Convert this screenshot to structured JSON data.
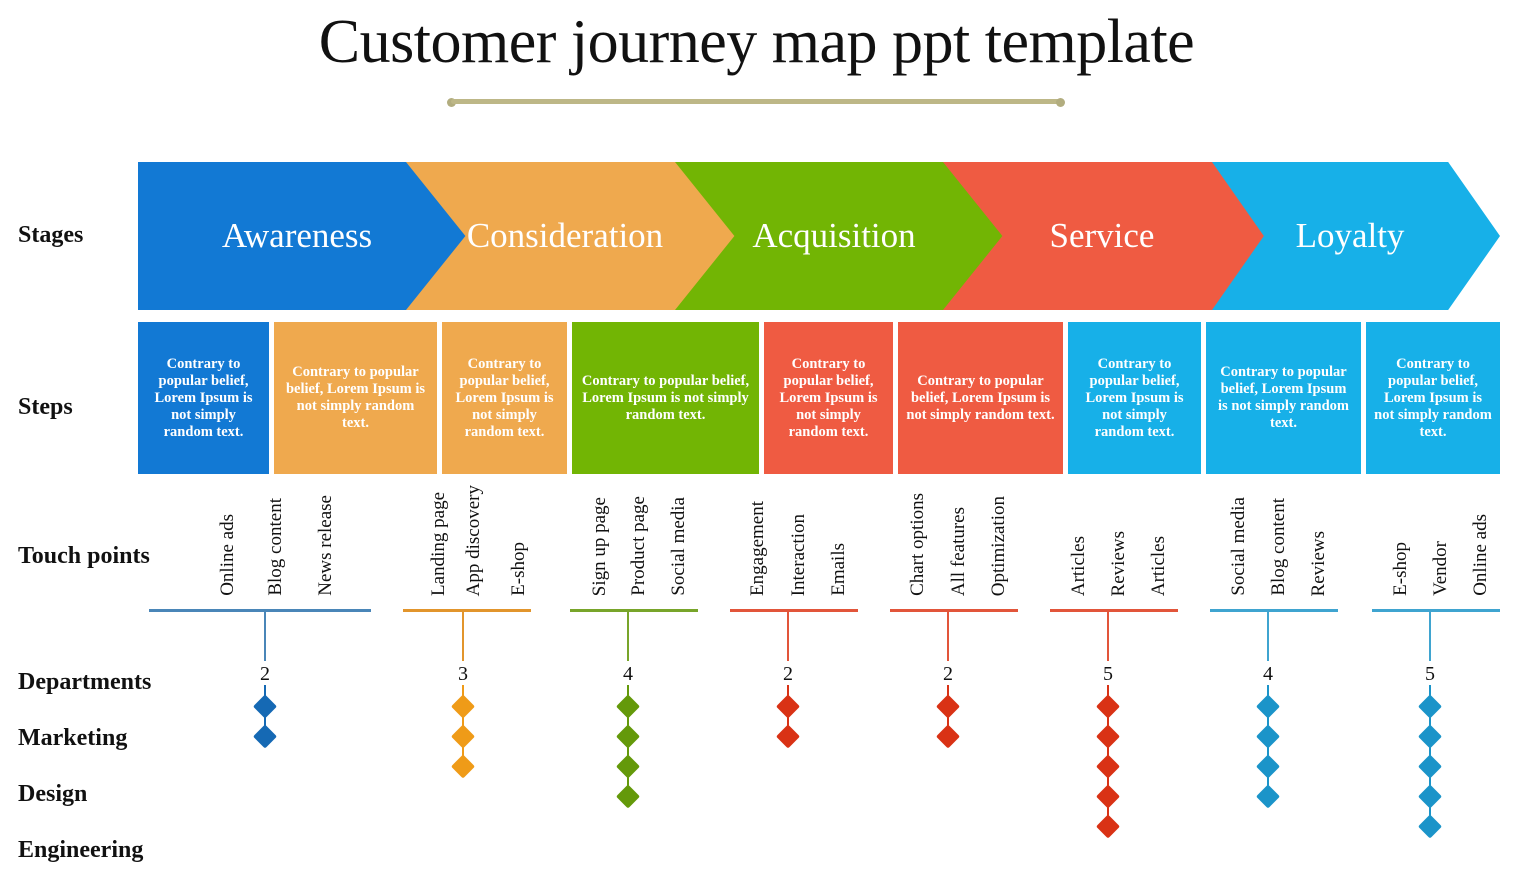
{
  "title": "Customer journey map ppt template",
  "row_labels": {
    "stages": "Stages",
    "steps": "Steps",
    "touch_points": "Touch points",
    "departments": "Departments",
    "marketing": "Marketing",
    "design": "Design",
    "engineering": "Engineering"
  },
  "colors": {
    "blue": "#1279d4",
    "orange": "#efa94e",
    "green": "#72b504",
    "red": "#ef5b42",
    "cyan": "#17b0e8",
    "rule_blue": "#4a86b8",
    "rule_orange": "#e2952c",
    "rule_green": "#78a52a",
    "rule_red": "#e2553a",
    "rule_cyan": "#3fa4d0",
    "title_rule": "#b2ad7f",
    "text_dark": "#111111",
    "text_light": "#ffffff"
  },
  "stages": [
    {
      "label": "Awareness",
      "color": "#1279d4"
    },
    {
      "label": "Consideration",
      "color": "#efa94e"
    },
    {
      "label": "Acquisition",
      "color": "#72b504"
    },
    {
      "label": "Service",
      "color": "#ef5b42"
    },
    {
      "label": "Loyalty",
      "color": "#17b0e8"
    }
  ],
  "step_text": "Contrary to popular belief, Lorem Ipsum is not simply random text.",
  "steps": [
    {
      "color": "#1279d4"
    },
    {
      "color": "#efa94e"
    },
    {
      "color": "#efa94e"
    },
    {
      "color": "#72b504"
    },
    {
      "color": "#ef5b42"
    },
    {
      "color": "#ef5b42"
    },
    {
      "color": "#17b0e8"
    },
    {
      "color": "#17b0e8"
    },
    {
      "color": "#17b0e8"
    }
  ],
  "touch_groups": [
    {
      "rule_color": "#4a86b8",
      "labels": [
        "Online ads",
        "Blog content",
        "News release"
      ]
    },
    {
      "rule_color": "#e2952c",
      "labels": [
        "Landing page",
        "App discovery",
        "E-shop"
      ]
    },
    {
      "rule_color": "#78a52a",
      "labels": [
        "Sign up page",
        "Product page",
        "Social media"
      ]
    },
    {
      "rule_color": "#e2553a",
      "labels": [
        "Engagement",
        "Interaction",
        "Emails"
      ]
    },
    {
      "rule_color": "#e2553a",
      "labels": [
        "Chart options",
        "All features",
        "Optimization"
      ]
    },
    {
      "rule_color": "#e2553a",
      "labels": [
        "Articles",
        "Reviews",
        "Articles"
      ]
    },
    {
      "rule_color": "#3fa4d0",
      "labels": [
        "Social media",
        "Blog content",
        "Reviews"
      ]
    },
    {
      "rule_color": "#3fa4d0",
      "labels": [
        "E-shop",
        "Vendor",
        "Online ads"
      ]
    }
  ],
  "departments": [
    {
      "count": "2",
      "color": "#1569b4"
    },
    {
      "count": "3",
      "color": "#ef9b18"
    },
    {
      "count": "4",
      "color": "#64990a"
    },
    {
      "count": "2",
      "color": "#d93215"
    },
    {
      "count": "2",
      "color": "#d93215"
    },
    {
      "count": "5",
      "color": "#d93215"
    },
    {
      "count": "4",
      "color": "#1b94c9"
    },
    {
      "count": "5",
      "color": "#1b94c9"
    }
  ],
  "chart_data": {
    "type": "table",
    "title": "Customer journey map ppt template",
    "rows": [
      "Stages",
      "Steps",
      "Touch points",
      "Departments",
      "Marketing",
      "Design",
      "Engineering"
    ],
    "stages": [
      "Awareness",
      "Consideration",
      "Acquisition",
      "Service",
      "Loyalty"
    ],
    "touch_point_groups": [
      [
        "Online ads",
        "Blog content",
        "News release"
      ],
      [
        "Landing page",
        "App discovery",
        "E-shop"
      ],
      [
        "Sign up page",
        "Product page",
        "Social media"
      ],
      [
        "Engagement",
        "Interaction",
        "Emails"
      ],
      [
        "Chart options",
        "All features",
        "Optimization"
      ],
      [
        "Articles",
        "Reviews",
        "Articles"
      ],
      [
        "Social media",
        "Blog content",
        "Reviews"
      ],
      [
        "E-shop",
        "Vendor",
        "Online ads"
      ]
    ],
    "department_counts": [
      2,
      3,
      4,
      2,
      2,
      5,
      4,
      5
    ]
  }
}
